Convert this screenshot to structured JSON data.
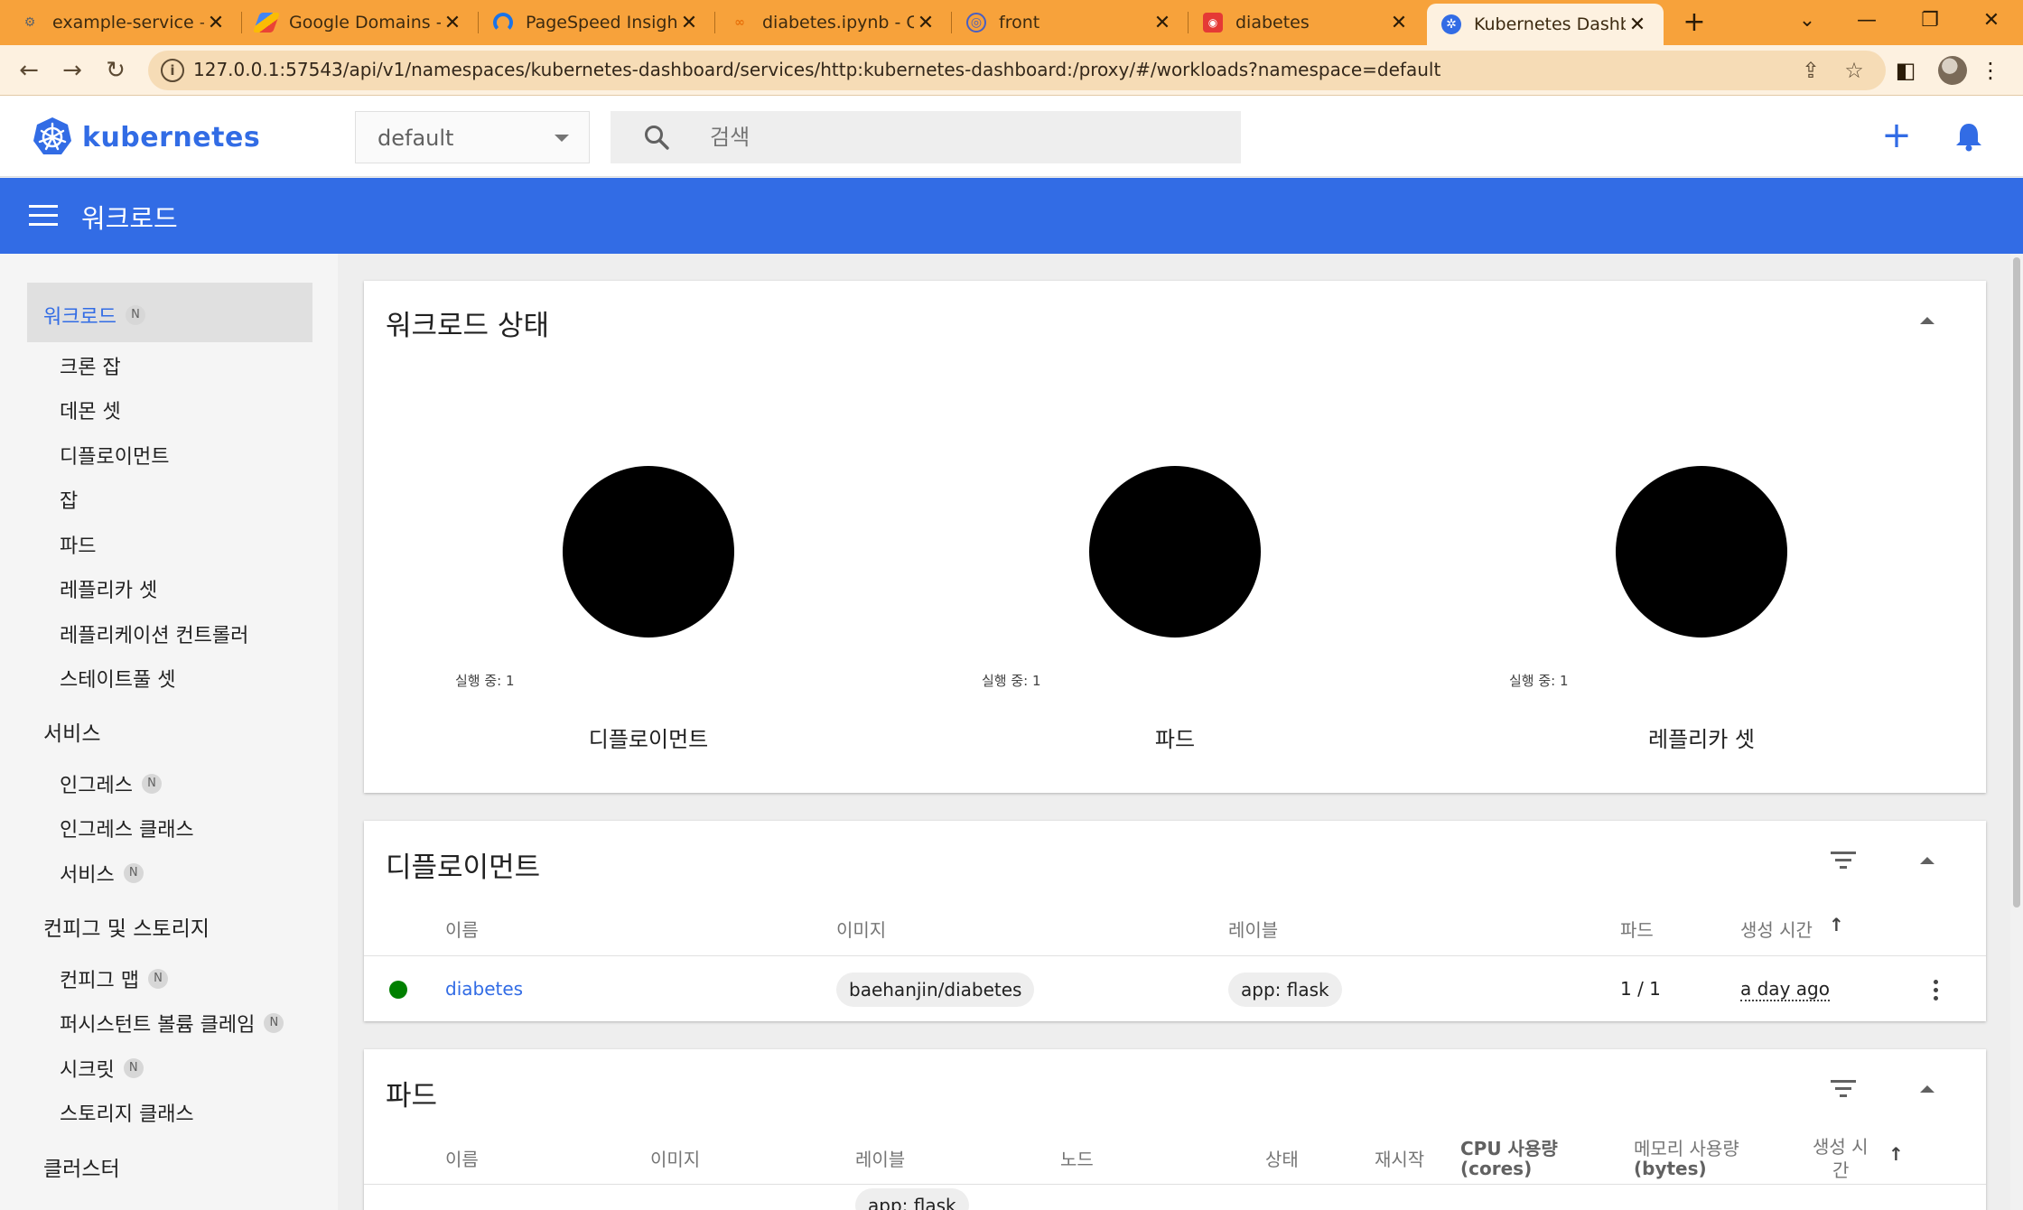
{
  "browser": {
    "tabs": [
      {
        "title": "example-service – A",
        "favicon": "gear-icon",
        "color": "#5f6368"
      },
      {
        "title": "Google Domains - S",
        "favicon": "google-domains-icon",
        "color": "#4285f4"
      },
      {
        "title": "PageSpeed Insights",
        "favicon": "pagespeed-icon",
        "color": "#1a73e8"
      },
      {
        "title": "diabetes.ipynb - Col",
        "favicon": "colab-icon",
        "color": "#f9ab00"
      },
      {
        "title": "front",
        "favicon": "globe-icon",
        "color": "#4a5fc1"
      },
      {
        "title": "diabetes",
        "favicon": "app-icon",
        "color": "#e53935"
      },
      {
        "title": "Kubernetes Dashbo",
        "favicon": "kubernetes-icon",
        "color": "#326ce5"
      }
    ],
    "url": "127.0.0.1:57543/api/v1/namespaces/kubernetes-dashboard/services/http:kubernetes-dashboard:/proxy/#/workloads?namespace=default"
  },
  "header": {
    "brand": "kubernetes",
    "namespace": "default",
    "search_placeholder": "검색"
  },
  "titlebar": {
    "title": "워크로드"
  },
  "sidebar": {
    "workloads": {
      "label": "워크로드",
      "badge": "N"
    },
    "workload_items": [
      "크론 잡",
      "데몬 셋",
      "디플로이먼트",
      "잡",
      "파드",
      "레플리카 셋",
      "레플리케이션 컨트롤러",
      "스테이트풀 셋"
    ],
    "services_section": "서비스",
    "service_items": [
      {
        "label": "인그레스",
        "badge": "N"
      },
      {
        "label": "인그레스 클래스",
        "badge": ""
      },
      {
        "label": "서비스",
        "badge": "N"
      }
    ],
    "config_section": "컨피그 및 스토리지",
    "config_items": [
      {
        "label": "컨피그 맵",
        "badge": "N"
      },
      {
        "label": "퍼시스턴트 볼륨 클레임",
        "badge": "N"
      },
      {
        "label": "시크릿",
        "badge": "N"
      },
      {
        "label": "스토리지 클래스",
        "badge": ""
      }
    ],
    "cluster_section": "클러스터"
  },
  "status_card": {
    "title": "워크로드 상태",
    "charts": [
      {
        "label": "디플로이먼트",
        "running": "실행 중: 1",
        "value": 1,
        "color": "#000000"
      },
      {
        "label": "파드",
        "running": "실행 중: 1",
        "value": 1,
        "color": "#000000"
      },
      {
        "label": "레플리카 셋",
        "running": "실행 중: 1",
        "value": 1,
        "color": "#000000"
      }
    ]
  },
  "deployments": {
    "title": "디플로이먼트",
    "columns": [
      "이름",
      "이미지",
      "레이블",
      "파드",
      "생성 시간"
    ],
    "rows": [
      {
        "name": "diabetes",
        "image": "baehanjin/diabetes",
        "label": "app: flask",
        "pods": "1 / 1",
        "created": "a day ago",
        "status_color": "#008000"
      }
    ]
  },
  "pods": {
    "title": "파드",
    "columns": [
      "이름",
      "이미지",
      "레이블",
      "노드",
      "상태",
      "재시작"
    ],
    "cpu_header": "CPU 사용량",
    "cpu_unit": "(cores)",
    "mem_header": "메모리 사용량",
    "mem_unit": "(bytes)",
    "created_header_1": "생성 시",
    "created_header_2": "간",
    "partial_label": "app: flask"
  }
}
